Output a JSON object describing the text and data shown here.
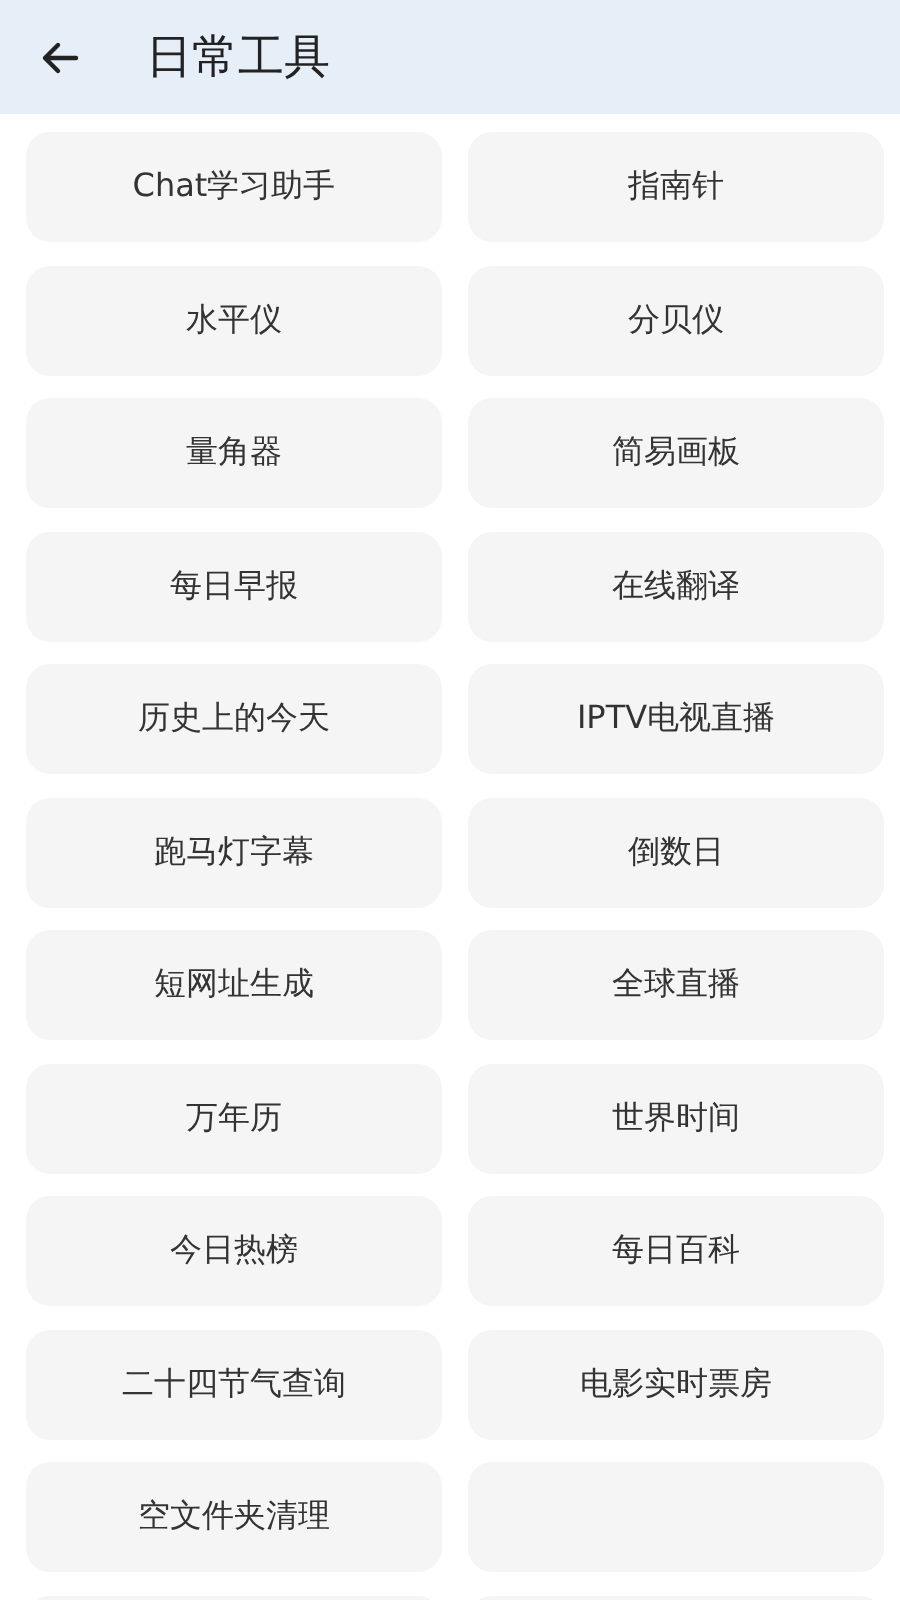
{
  "header": {
    "title": "日常工具"
  },
  "tools": [
    {
      "label": "Chat学习助手"
    },
    {
      "label": "指南针"
    },
    {
      "label": "水平仪"
    },
    {
      "label": "分贝仪"
    },
    {
      "label": "量角器"
    },
    {
      "label": "简易画板"
    },
    {
      "label": "每日早报"
    },
    {
      "label": "在线翻译"
    },
    {
      "label": "历史上的今天"
    },
    {
      "label": "IPTV电视直播"
    },
    {
      "label": "跑马灯字幕"
    },
    {
      "label": "倒数日"
    },
    {
      "label": "短网址生成"
    },
    {
      "label": "全球直播"
    },
    {
      "label": "万年历"
    },
    {
      "label": "世界时间"
    },
    {
      "label": "今日热榜"
    },
    {
      "label": "每日百科"
    },
    {
      "label": "二十四节气查询"
    },
    {
      "label": "电影实时票房"
    },
    {
      "label": "空文件夹清理"
    }
  ]
}
